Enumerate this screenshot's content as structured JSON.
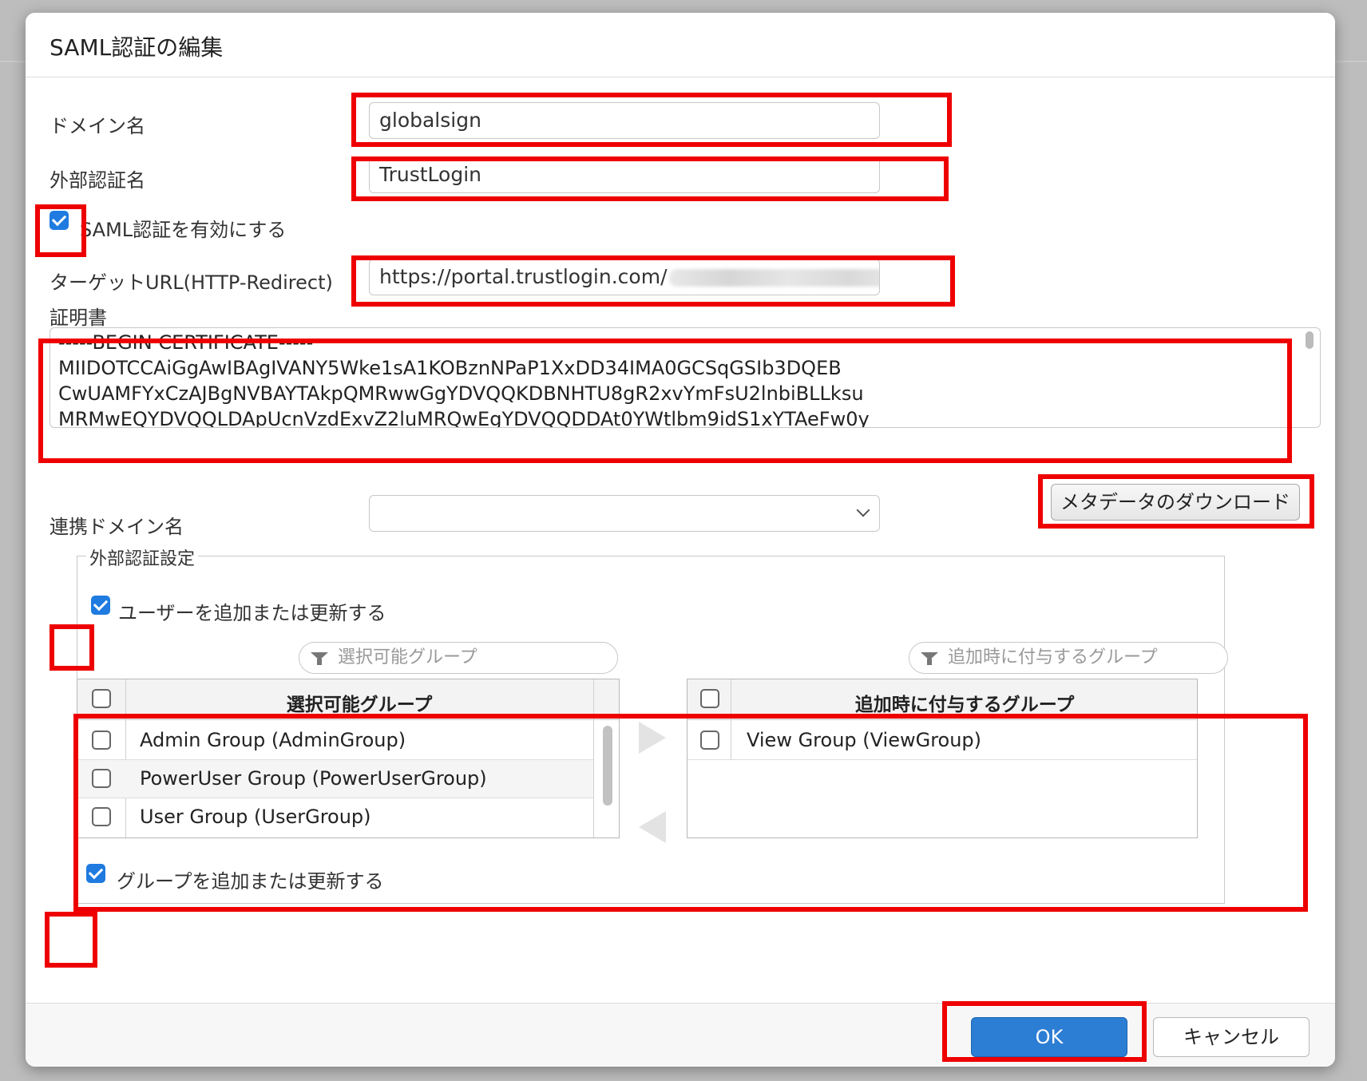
{
  "dialog": {
    "title": "SAML認証の編集",
    "domain_label": "ドメイン名",
    "domain_value": "globalsign",
    "external_auth_label": "外部認証名",
    "external_auth_value": "TrustLogin",
    "enable_saml_label": "SAML認証を有効にする",
    "enable_saml_checked": true,
    "target_url_label": "ターゲットURL(HTTP-Redirect)",
    "target_url_value": "https://portal.trustlogin.com/",
    "certificate_label": "証明書",
    "certificate_lines": [
      "-----BEGIN CERTIFICATE-----",
      "MIIDOTCCAiGgAwIBAgIVANY5Wke1sA1KOBznNPaP1XxDD34IMA0GCSqGSIb3DQEB",
      "CwUAMFYxCzAJBgNVBAYTAkpQMRwwGgYDVQQKDBNHTU8gR2xvYmFsU2lnbiBLLksu",
      "MRMwEQYDVQQLDApUcnVzdExvZ2luMRQwEgYDVQQDDAt0YWtlbm9idS1xYTAeFw0y"
    ],
    "metadata_download_label": "メタデータのダウンロード",
    "linked_domain_label": "連携ドメイン名",
    "linked_domain_value": ""
  },
  "external_auth_settings": {
    "legend": "外部認証設定",
    "add_update_users_label": "ユーザーを追加または更新する",
    "add_update_users_checked": true,
    "available_filter_placeholder": "選択可能グループ",
    "assigned_filter_placeholder": "追加時に付与するグループ",
    "available_header": "選択可能グループ",
    "assigned_header": "追加時に付与するグループ",
    "available_groups": [
      "Admin Group (AdminGroup)",
      "PowerUser Group (PowerUserGroup)",
      "User Group (UserGroup)"
    ],
    "assigned_groups": [
      "View Group (ViewGroup)"
    ],
    "add_update_groups_label": "グループを追加または更新する",
    "add_update_groups_checked": true
  },
  "footer": {
    "ok_label": "OK",
    "cancel_label": "キャンセル"
  },
  "colors": {
    "highlight": "#ee0000",
    "primary_button": "#2c7dd4",
    "checkbox": "#1f7be0"
  }
}
